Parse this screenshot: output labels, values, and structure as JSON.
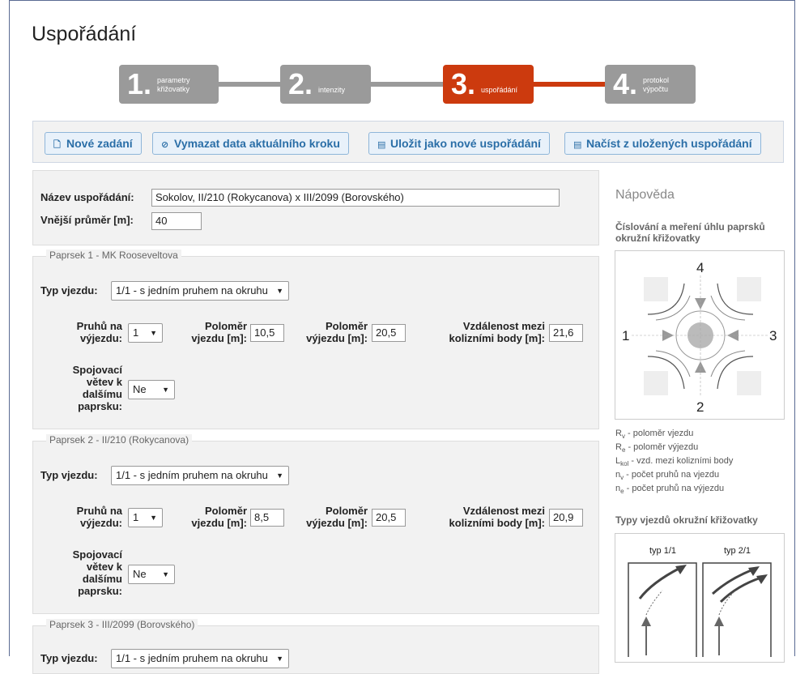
{
  "page": {
    "title": "Uspořádání"
  },
  "steps": [
    {
      "num": "1.",
      "label1": "parametry",
      "label2": "křižovatky",
      "active": false
    },
    {
      "num": "2.",
      "label1": "intenzity",
      "label2": "",
      "active": false
    },
    {
      "num": "3.",
      "label1": "uspořádání",
      "label2": "",
      "active": true
    },
    {
      "num": "4.",
      "label1": "protokol",
      "label2": "výpočtu",
      "active": false
    }
  ],
  "toolbar": {
    "new": "Nové zadání",
    "clear": "Vymazat data aktuálního kroku",
    "save": "Uložit jako nové uspořádání",
    "load": "Načíst z uložených uspořádání"
  },
  "form": {
    "name_label": "Název uspořádání:",
    "name_value": "Sokolov, II/210 (Rokycanova) x III/2099 (Borovského)",
    "diameter_label": "Vnější průměr [m]:",
    "diameter_value": "40"
  },
  "labels": {
    "typ": "Typ vjezdu:",
    "pruhu1": "Pruhů na",
    "pruhu2": "výjezdu:",
    "polv1": "Poloměr",
    "polv2": "vjezdu [m]:",
    "polvy1": "Poloměr",
    "polvy2": "výjezdu [m]:",
    "vzd1": "Vzdálenost mezi",
    "vzd2": "kolizními body [m]:",
    "spoj1": "Spojovací",
    "spoj2": "větev k",
    "spoj3": "dalšímu",
    "spoj4": "paprsku:"
  },
  "paprsky": [
    {
      "legend": "Paprsek 1 - MK Rooseveltova",
      "typ": "1/1 - s jedním pruhem na okruhu",
      "pruhu": "1",
      "polomer_vjezdu": "10,5",
      "polomer_vyjezdu": "20,5",
      "vzdalenost": "21,6",
      "spojovaci": "Ne"
    },
    {
      "legend": "Paprsek 2 - II/210 (Rokycanova)",
      "typ": "1/1 - s jedním pruhem na okruhu",
      "pruhu": "1",
      "polomer_vjezdu": "8,5",
      "polomer_vyjezdu": "20,5",
      "vzdalenost": "20,9",
      "spojovaci": "Ne"
    },
    {
      "legend": "Paprsek 3 - III/2099 (Borovského)",
      "typ": "1/1 - s jedním pruhem na okruhu"
    }
  ],
  "help": {
    "title": "Nápověda",
    "sub1": "Číslování a meření úhlu paprsků",
    "sub2": "okružní křižovatky",
    "diagram": {
      "n4": "4",
      "n1": "1",
      "n3": "3",
      "n2": "2"
    },
    "legend": [
      {
        "sym": "R",
        "sub": "v",
        "text": " - poloměr vjezdu"
      },
      {
        "sym": "R",
        "sub": "e",
        "text": " - poloměr výjezdu"
      },
      {
        "sym": "L",
        "sub": "kol",
        "text": " - vzd. mezi kolizními body"
      },
      {
        "sym": "n",
        "sub": "v",
        "text": " - počet pruhů na vjezdu"
      },
      {
        "sym": "n",
        "sub": "e",
        "text": " - počet pruhů na výjezdu"
      }
    ],
    "types_title": "Typy vjezdů okružní křižovatky",
    "type_a": "typ 1/1",
    "type_b": "typ 2/1"
  }
}
